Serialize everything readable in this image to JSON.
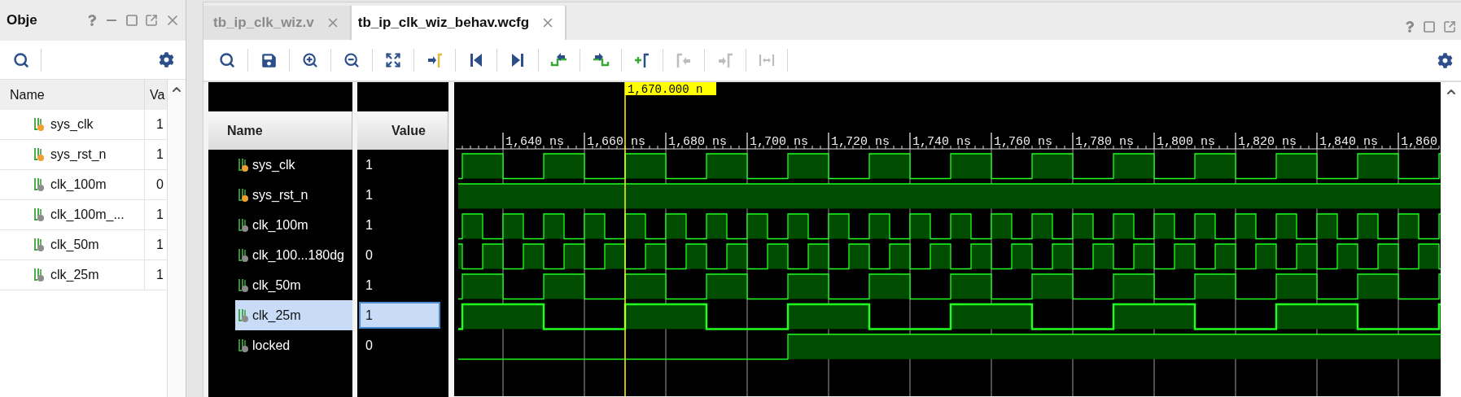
{
  "objects_panel": {
    "title": "Obje",
    "columns": [
      "Name",
      "Va"
    ],
    "rows": [
      {
        "name": "sys_clk",
        "value": "1",
        "color": "#f0a030"
      },
      {
        "name": "sys_rst_n",
        "value": "1",
        "color": "#f0a030"
      },
      {
        "name": "clk_100m",
        "value": "0",
        "color": "#8c8c8c"
      },
      {
        "name": "clk_100m_...",
        "value": "1",
        "color": "#8c8c8c"
      },
      {
        "name": "clk_50m",
        "value": "1",
        "color": "#8c8c8c"
      },
      {
        "name": "clk_25m",
        "value": "1",
        "color": "#8c8c8c"
      }
    ]
  },
  "tabs": [
    {
      "label": "tb_ip_clk_wiz.v",
      "selected": false
    },
    {
      "label": "tb_ip_clk_wiz_behav.wcfg",
      "selected": true
    }
  ],
  "toolbar": {
    "buttons": [
      {
        "disabled": false
      },
      {
        "disabled": false
      },
      {
        "disabled": false
      },
      {
        "disabled": false
      },
      {
        "disabled": false
      },
      {
        "disabled": false
      },
      {
        "disabled": false
      },
      {
        "disabled": false
      },
      {
        "disabled": false
      },
      {
        "disabled": false
      },
      {
        "disabled": false
      },
      {
        "disabled": true
      },
      {
        "disabled": true
      },
      {
        "disabled": true
      }
    ]
  },
  "wave_window": {
    "columns": [
      "Name",
      "Value"
    ],
    "cursor_label": "1,670.000 n",
    "ruler_labels": [
      "1,640 ns",
      "1,660 ns",
      "1,680 ns",
      "1,700 ns",
      "1,720 ns",
      "1,740 ns",
      "1,760 ns",
      "1,780 ns",
      "1,800 ns",
      "1,820 ns",
      "1,840 ns",
      "1,860"
    ],
    "signals": [
      {
        "name": "sys_clk",
        "value": "1",
        "color": "#f0a030",
        "selected": false
      },
      {
        "name": "sys_rst_n",
        "value": "1",
        "color": "#f0a030",
        "selected": false
      },
      {
        "name": "clk_100m",
        "value": "1",
        "color": "#8c8c8c",
        "selected": false
      },
      {
        "name": "clk_100...180dg",
        "value": "0",
        "color": "#8c8c8c",
        "selected": false
      },
      {
        "name": "clk_50m",
        "value": "1",
        "color": "#8c8c8c",
        "selected": false
      },
      {
        "name": "clk_25m",
        "value": "1",
        "color": "#8c8c8c",
        "selected": true
      },
      {
        "name": "locked",
        "value": "0",
        "color": "#8c8c8c",
        "selected": false
      }
    ]
  }
}
